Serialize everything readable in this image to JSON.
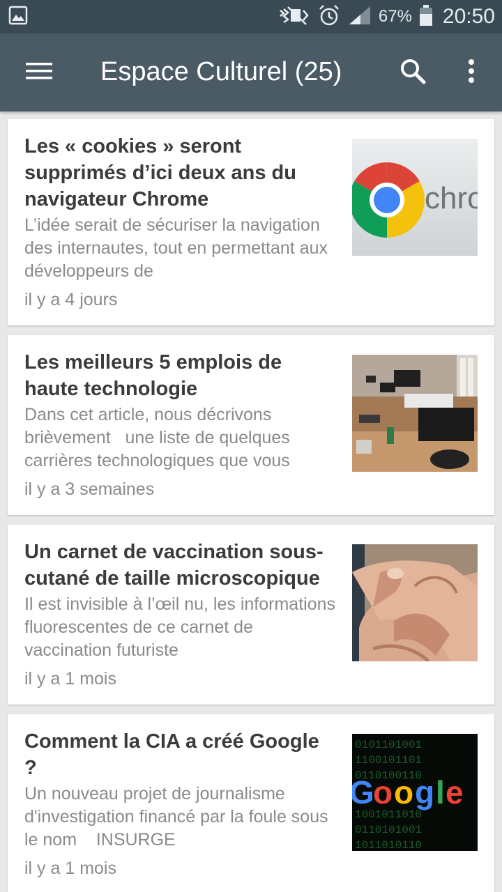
{
  "status_bar": {
    "battery": "67%",
    "time": "20:50",
    "icons": [
      "gallery-icon",
      "mute-icon",
      "alarm-icon",
      "signal-icon",
      "battery-icon"
    ]
  },
  "app_bar": {
    "title": "Espace Culturel (25)",
    "icons": [
      "menu-icon",
      "search-icon",
      "more-vert-icon"
    ]
  },
  "articles": [
    {
      "title": "Les « cookies » seront supprimés d’ici deux ans du navigateur Chrome",
      "summary": "L’idée serait de sécuriser la navigation des internautes, tout en permettant aux développeurs de",
      "date": "il y a 4 jours",
      "thumb_text": "chrom",
      "thumb": "chrome-logo-image"
    },
    {
      "title": "Les meilleurs 5 emplois de haute technologie",
      "summary": "Dans cet article, nous décrivons brièvement   une liste de quelques carrières technologiques que vous",
      "date": "il y a 3 semaines",
      "thumb": "office-photo-image"
    },
    {
      "title": "Un carnet de vaccination sous-cutané de taille microscopique",
      "summary": "Il est invisible à l’œil nu, les informations fluorescentes de ce carnet de vaccination futuriste",
      "date": "il y a 1 mois",
      "thumb": "hands-photo-image"
    },
    {
      "title": "Comment la CIA a créé Google ?",
      "summary": "Un nouveau projet de journalisme d'investigation financé par la foule sous le nom    INSURGE",
      "date": "il y a 1 mois",
      "thumb_text": "Google",
      "thumb": "google-logo-image"
    }
  ],
  "colors": {
    "status_bar": "#3a4a55",
    "app_bar": "#4a5b66",
    "background": "#e8e8e8",
    "title_text": "#3b3b3b",
    "secondary_text": "#8a8a8a"
  }
}
